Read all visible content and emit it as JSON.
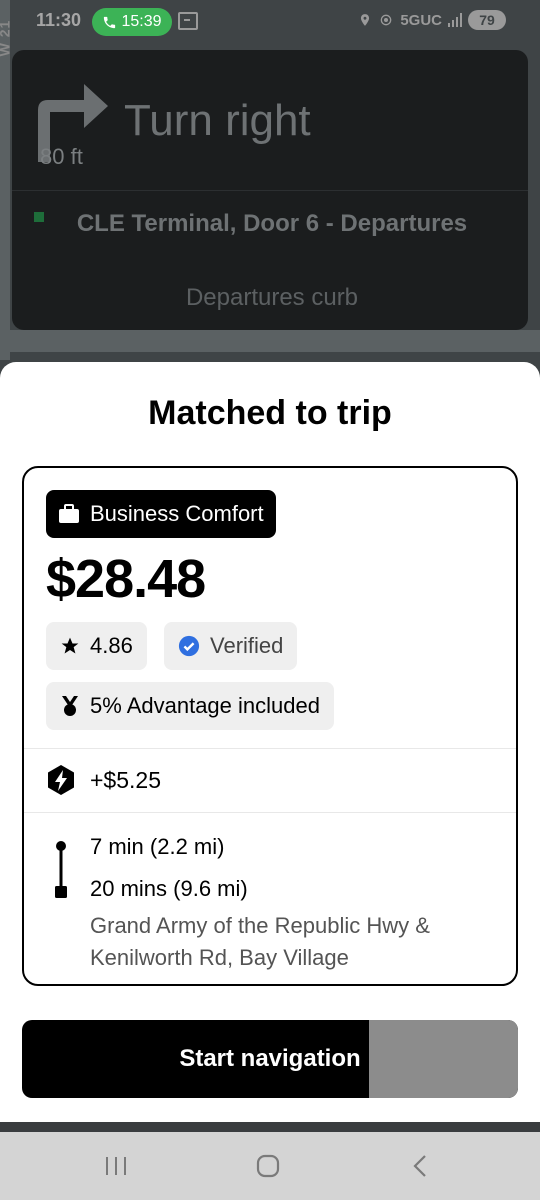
{
  "status_bar": {
    "time": "11:30",
    "call_duration": "15:39",
    "network": "5GUC",
    "battery": "79"
  },
  "map": {
    "street_label": "W 21"
  },
  "navigation": {
    "maneuver": "Turn right",
    "distance": "80 ft",
    "destination_title": "CLE Terminal, Door 6 - Departures",
    "destination_sub": "Departures curb"
  },
  "sheet": {
    "title": "Matched to trip",
    "product": "Business Comfort",
    "fare": "$28.48",
    "rating": "4.86",
    "verified": "Verified",
    "advantage": "5% Advantage included",
    "surge": "+$5.25",
    "pickup_eta": "7 min (2.2 mi)",
    "trip_eta": "20 mins (9.6 mi)",
    "dropoff_address": "Grand Army of the Republic Hwy & Kenilworth Rd, Bay Village",
    "start_button": "Start navigation",
    "start_button_progress": 0.7
  },
  "colors": {
    "verified_blue": "#2f6fe0",
    "call_green": "#3cb356"
  },
  "icons": [
    "phone-icon",
    "cast-icon",
    "location-icon",
    "hotspot-icon",
    "signal-icon",
    "turn-right-icon",
    "briefcase-icon",
    "star-icon",
    "verified-badge-icon",
    "medal-icon",
    "surge-bolt-icon",
    "recents-icon",
    "home-icon",
    "back-icon"
  ]
}
